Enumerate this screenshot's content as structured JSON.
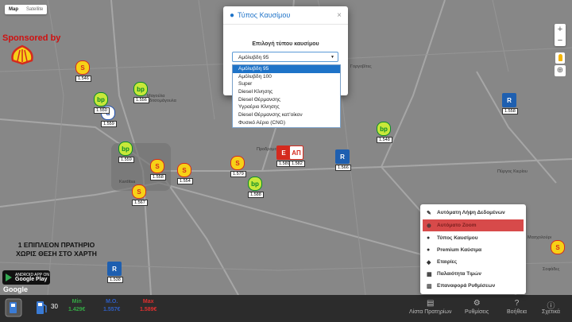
{
  "map": {
    "type_map": "Map",
    "type_satellite": "Satellite",
    "sponsored": "Sponsored by",
    "promo_line1": "1 ΕΠΙΠΛΕΟΝ ΠΡΑΤΗΡΙΟ",
    "promo_line2": "ΧΩΡΙΣ ΘΕΣΗ ΣΤΟ ΧΑΡΤΗ",
    "google_play_small": "ANDROID APP ON",
    "google_play": "Google Play",
    "google_logo": "Google",
    "zoom_in": "+",
    "zoom_out": "−",
    "places": [
      {
        "name": "Karditsa",
        "cls": "pl-karditsa"
      },
      {
        "name": "Μαγούλα",
        "cls": "pl-magoula"
      },
      {
        "name": "Μαγούλα Σταυρού",
        "cls": "pl-stavrou"
      },
      {
        "name": "Προδρομος",
        "cls": "pl-prodromos"
      },
      {
        "name": "Γοργοβίτες",
        "cls": "pl-gorgovites"
      },
      {
        "name": "Πύργος Κιερίου",
        "cls": "pl-pyrgos"
      },
      {
        "name": "Καρδιτσομάγουλα",
        "cls": "pl-kardmag"
      },
      {
        "name": "Μασχολούρι",
        "cls": "pl-mascholouri"
      },
      {
        "name": "Σοφάδες",
        "cls": "pl-sofades"
      },
      {
        "name": "Καρδιτσομάγουλα",
        "cls": "pl-kardmag2"
      }
    ],
    "markers": [
      {
        "price": "1.546",
        "brand": "shell"
      },
      {
        "price": "1.556",
        "brand": "bp"
      },
      {
        "price": "1.559",
        "brand": "d"
      },
      {
        "price": "1.550",
        "brand": "bp"
      },
      {
        "price": "1.558",
        "brand": "shell"
      },
      {
        "price": "1.554",
        "brand": "shell"
      },
      {
        "price": "1.567",
        "brand": "shell"
      },
      {
        "price": "1.559",
        "brand": "bp"
      },
      {
        "price": "1.589",
        "brand": "eko"
      },
      {
        "price": "1.582",
        "brand": "ap"
      },
      {
        "price": "1.579",
        "brand": "bp"
      },
      {
        "price": "1.566",
        "brand": "revoil"
      },
      {
        "price": "1.588",
        "brand": "bp"
      },
      {
        "price": "1.558",
        "brand": "revoil"
      },
      {
        "price": "1.538",
        "brand": "revoil"
      },
      {
        "price": "1.548",
        "brand": "bp"
      }
    ],
    "ap_label": "ΑΠ"
  },
  "modal": {
    "title": "Τύπος Καυσίμου",
    "close": "×",
    "label": "Επιλογή τύπου καυσίμου",
    "selected": "Αμόλυβδη 95",
    "options": [
      "Αμόλυβδη 95",
      "Αμόλυβδη 100",
      "Super",
      "Diesel Κίνησης",
      "Diesel Θέρμανσης",
      "Υγραέριο Κίνησης",
      "Diesel Θέρμανσης κατ'οίκον",
      "Φυσικό Αέριο (CNG)"
    ]
  },
  "menu": {
    "items": [
      "Αυτόματη Λήψη Δεδομένων",
      "Αυτόματο Zoom",
      "Τύπος Καυσίμου",
      "Premium Καύσιμα",
      "Εταιρίες",
      "Παλαιότητα Τιμών",
      "Επαναφορά Ρυθμίσεων"
    ]
  },
  "bottom": {
    "count": "30",
    "min_label": "Min",
    "min_value": "1.429€",
    "avg_label": "M.O.",
    "avg_value": "1.557€",
    "max_label": "Max",
    "max_value": "1.589€",
    "nav": [
      "Λίστα Πρατηρίων",
      "Ρυθμίσεις",
      "Βοήθεια",
      "Σχετικά"
    ]
  },
  "colors": {
    "min": "#35a845",
    "avg": "#2f5fc4",
    "max": "#e0302f",
    "accent": "#1e73c8",
    "menu_active": "#d74a4a"
  }
}
